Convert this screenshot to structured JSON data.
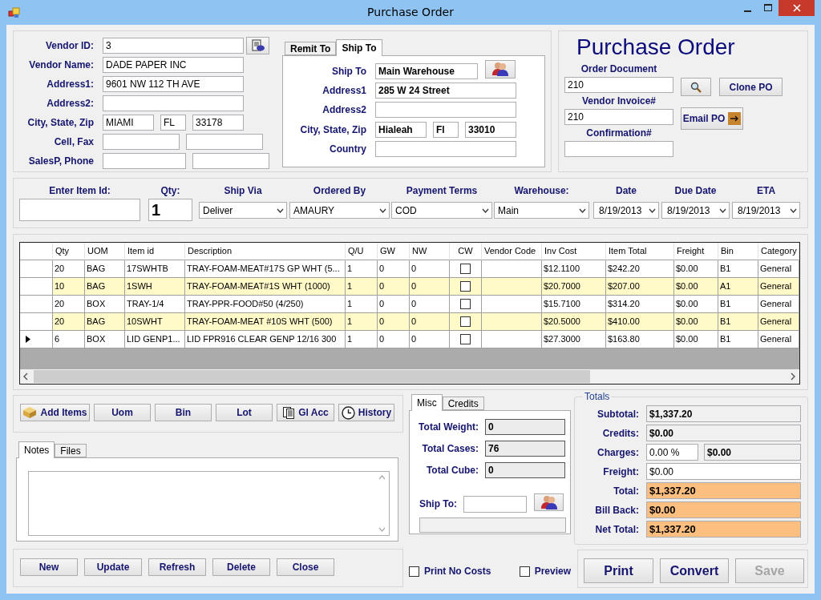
{
  "window": {
    "title": "Purchase Order"
  },
  "vendor": {
    "rows": [
      {
        "label": "Vendor ID:",
        "kind": "lookup",
        "inputs": [
          {
            "kind": "text",
            "value": "3"
          }
        ]
      },
      {
        "label": "Vendor Name:",
        "kind": "text",
        "inputs": [
          {
            "kind": "text",
            "value": "DADE PAPER INC"
          }
        ]
      },
      {
        "label": "Address1:",
        "kind": "text",
        "inputs": [
          {
            "kind": "text",
            "value": "9601 NW 112 TH AVE"
          }
        ]
      },
      {
        "label": "Address2:",
        "kind": "text",
        "inputs": [
          {
            "kind": "text"
          }
        ]
      },
      {
        "label": "City, State, Zip",
        "kind": "text",
        "inputs": [
          {
            "kind": "text",
            "value": "MIAMI"
          },
          {
            "kind": "text",
            "value": "FL"
          },
          {
            "kind": "text",
            "value": "33178"
          }
        ]
      },
      {
        "label": "Cell, Fax",
        "kind": "text",
        "inputs": [
          {
            "kind": "text"
          },
          {
            "kind": "text"
          }
        ]
      },
      {
        "label": "SalesP, Phone",
        "kind": "text",
        "inputs": [
          {
            "kind": "text"
          },
          {
            "kind": "text"
          }
        ]
      }
    ]
  },
  "address_tabs": [
    {
      "label": "Remit To",
      "selected": false
    },
    {
      "label": "Ship To",
      "selected": true
    }
  ],
  "ship_to": {
    "rows": [
      {
        "label": "Ship To",
        "kind": "lookup",
        "inputs": [
          {
            "kind": "text",
            "value": "Main Warehouse"
          }
        ]
      },
      {
        "label": "Address1",
        "kind": "text",
        "inputs": [
          {
            "kind": "text",
            "value": "285 W 24 Street"
          }
        ]
      },
      {
        "label": "Address2",
        "kind": "text",
        "inputs": [
          {
            "kind": "text"
          }
        ]
      },
      {
        "label": "City, State, Zip",
        "kind": "text",
        "inputs": [
          {
            "kind": "text",
            "value": "Hialeah"
          },
          {
            "kind": "text",
            "value": "Fl"
          },
          {
            "kind": "text",
            "value": "33010"
          }
        ]
      },
      {
        "label": "Country",
        "kind": "text",
        "inputs": [
          {
            "kind": "text"
          }
        ]
      }
    ]
  },
  "order": {
    "heading": "Purchase Order",
    "fields": [
      {
        "label": "Order Document",
        "value": "210"
      },
      {
        "label": "Vendor Invoice#",
        "value": "210"
      },
      {
        "label": "Confirmation#"
      }
    ],
    "buttons": [
      {
        "kind": "search"
      },
      {
        "kind": "text",
        "label": "Clone PO"
      },
      {
        "kind": "email",
        "label": "Email PO"
      }
    ]
  },
  "item_entry": [
    {
      "label": "Enter Item Id:",
      "kind": "text"
    },
    {
      "label": "Qty:",
      "kind": "qty",
      "value": "1"
    },
    {
      "label": "Ship Via",
      "kind": "combo",
      "value": "Deliver"
    },
    {
      "label": "Ordered By",
      "kind": "combo",
      "value": "AMAURY"
    },
    {
      "label": "Payment Terms",
      "kind": "combo",
      "value": "COD"
    },
    {
      "label": "Warehouse:",
      "kind": "combo",
      "value": "Main"
    },
    {
      "label": "Date",
      "kind": "date",
      "value": "8/19/2013"
    },
    {
      "label": "Due Date",
      "kind": "date",
      "value": "8/19/2013"
    },
    {
      "label": "ETA",
      "kind": "date",
      "value": "8/19/2013"
    }
  ],
  "grid": {
    "columns": [
      "Qty",
      "UOM",
      "Item id",
      "Description",
      "Q/U",
      "GW",
      "NW",
      "CW",
      "Vendor Code",
      "Inv Cost",
      "Item Total",
      "Freight",
      "Bin",
      "Category"
    ],
    "rows": [
      {
        "current": false,
        "qty": "20",
        "uom": "BAG",
        "item_id": "17SWHTB",
        "description": "TRAY-FOAM-MEAT#17S GP  WHT (5...",
        "qu": "1",
        "gw": "0",
        "nw": "0",
        "cw": false,
        "inv_cost": "$12.1100",
        "item_total": "$242.20",
        "freight": "$0.00",
        "bin": "B1",
        "category": "General"
      },
      {
        "current": false,
        "qty": "10",
        "uom": "BAG",
        "item_id": "1SWH",
        "description": "TRAY-FOAM-MEAT#1S WHT (1000)",
        "qu": "1",
        "gw": "0",
        "nw": "0",
        "cw": false,
        "inv_cost": "$20.7000",
        "item_total": "$207.00",
        "freight": "$0.00",
        "bin": "A1",
        "category": "General"
      },
      {
        "current": false,
        "qty": "20",
        "uom": "BOX",
        "item_id": "TRAY-1/4",
        "description": "TRAY-PPR-FOOD#50 (4/250)",
        "qu": "1",
        "gw": "0",
        "nw": "0",
        "cw": false,
        "inv_cost": "$15.7100",
        "item_total": "$314.20",
        "freight": "$0.00",
        "bin": "B1",
        "category": "General"
      },
      {
        "current": false,
        "qty": "20",
        "uom": "BAG",
        "item_id": "10SWHT",
        "description": "TRAY-FOAM-MEAT #10S WHT (500)",
        "qu": "1",
        "gw": "0",
        "nw": "0",
        "cw": false,
        "inv_cost": "$20.5000",
        "item_total": "$410.00",
        "freight": "$0.00",
        "bin": "B1",
        "category": "General"
      },
      {
        "current": true,
        "qty": "6",
        "uom": "BOX",
        "item_id": "LID GENP1...",
        "description": "LID FPR916 CLEAR GENP 12/16 300",
        "qu": "1",
        "gw": "0",
        "nw": "0",
        "cw": false,
        "inv_cost": "$27.3000",
        "item_total": "$163.80",
        "freight": "$0.00",
        "bin": "B1",
        "category": "General"
      }
    ]
  },
  "item_buttons": [
    {
      "label": "Add Items",
      "kind": "box"
    },
    {
      "label": "Uom",
      "kind": "plain"
    },
    {
      "label": "Bin",
      "kind": "plain"
    },
    {
      "label": "Lot",
      "kind": "plain"
    },
    {
      "label": "Gl Acc",
      "kind": "docs"
    },
    {
      "label": "History",
      "kind": "clock"
    }
  ],
  "notes_tabs": [
    {
      "label": "Notes",
      "selected": true
    },
    {
      "label": "Files",
      "selected": false
    }
  ],
  "form_buttons": [
    "New",
    "Update",
    "Refresh",
    "Delete",
    "Close"
  ],
  "misc_tabs": [
    {
      "label": "Misc",
      "selected": true
    },
    {
      "label": "Credits",
      "selected": false
    }
  ],
  "misc": {
    "fields": [
      {
        "label": "Total Weight:",
        "value": "0"
      },
      {
        "label": "Total Cases:",
        "value": "76"
      },
      {
        "label": "Total Cube:",
        "value": "0"
      }
    ],
    "ship_to_label": "Ship To:"
  },
  "print_options": [
    {
      "label": "Print No Costs",
      "checked": false
    },
    {
      "label": "Preview",
      "checked": false
    }
  ],
  "totals": {
    "title": "Totals",
    "rows": [
      {
        "label": "Subtotal:",
        "kind": "readonly",
        "values": [
          "$1,337.20"
        ]
      },
      {
        "label": "Credits:",
        "kind": "readonly",
        "values": [
          "$0.00"
        ]
      },
      {
        "label": "Charges:",
        "kind": "split",
        "values": [
          "0.00 %",
          "$0.00"
        ]
      },
      {
        "label": "Freight:",
        "kind": "input",
        "values": [
          "$0.00"
        ]
      },
      {
        "label": "Total:",
        "kind": "highlight",
        "values": [
          "$1,337.20"
        ]
      },
      {
        "label": "Bill Back:",
        "kind": "highlight",
        "values": [
          "$0.00"
        ]
      },
      {
        "label": "Net Total:",
        "kind": "highlight",
        "values": [
          "$1,337.20"
        ]
      }
    ]
  },
  "actions": [
    {
      "label": "Print",
      "disabled": false
    },
    {
      "label": "Convert",
      "disabled": false
    },
    {
      "label": "Save",
      "disabled": true
    }
  ]
}
